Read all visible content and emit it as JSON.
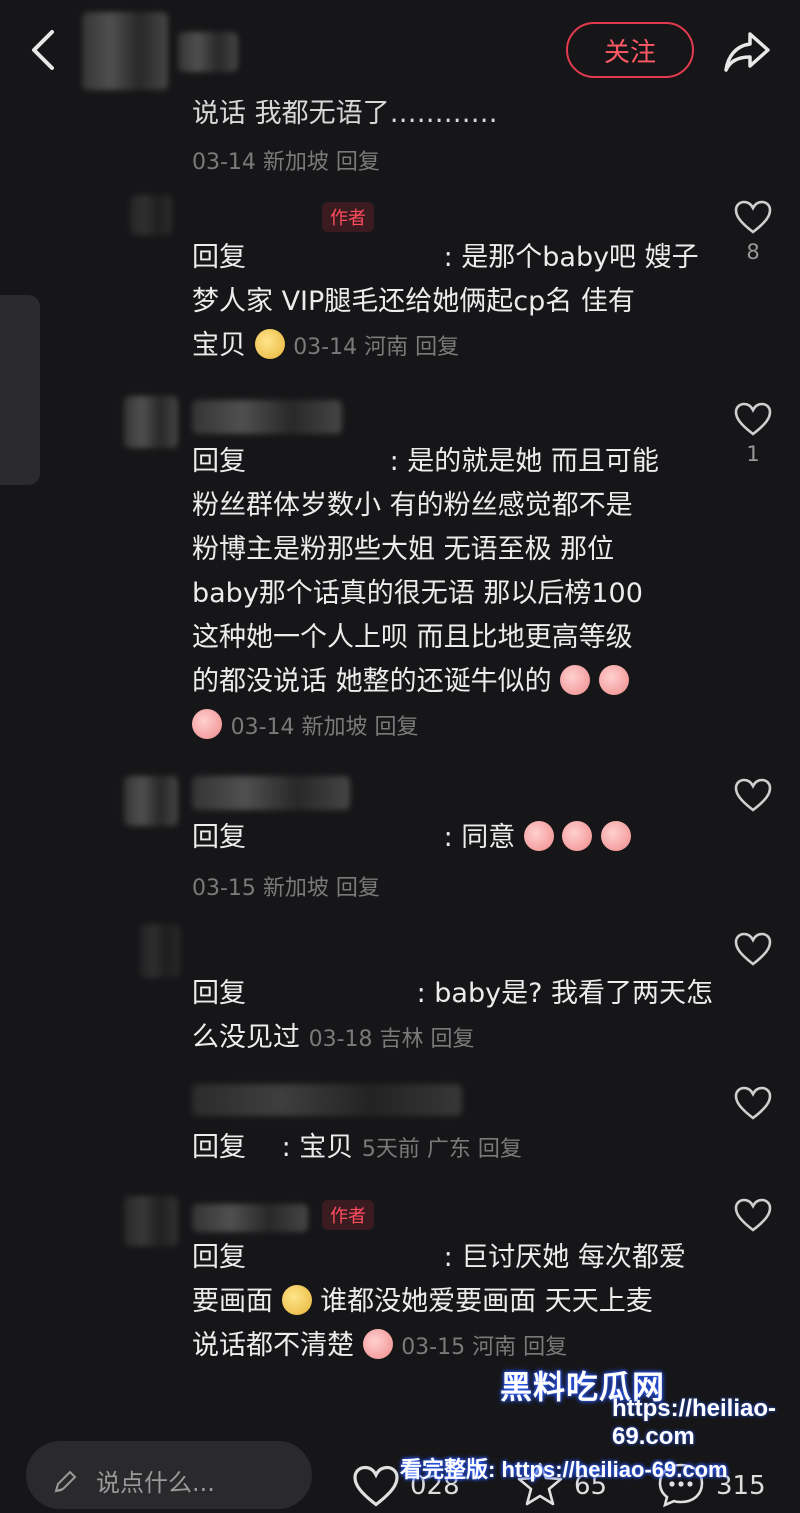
{
  "header": {
    "follow_label": "关注"
  },
  "partial": {
    "text": "说话 我都无语了…………",
    "meta": "03-14 新加坡 回复"
  },
  "comments": [
    {
      "author_tag": "作者",
      "lines": [
        "回复 　　　　　　　: 是那个baby吧 嫂子",
        "梦人家 VIP腿毛还给她俩起cp名 佳有",
        "宝贝"
      ],
      "meta": "03-14 河南 回复",
      "likes": "8"
    },
    {
      "lines": [
        "回复 　　　　　: 是的就是她  而且可能",
        "粉丝群体岁数小 有的粉丝感觉都不是",
        "粉博主是粉那些大姐 无语至极 那位",
        "baby那个话真的很无语 那以后榜100",
        "这种她一个人上呗 而且比地更高等级",
        "的都没说话 她整的还诞牛似的"
      ],
      "meta": "03-14 新加坡 回复",
      "likes": "1"
    },
    {
      "lines": [
        "回复 　　　　　　　: 同意"
      ],
      "meta": "03-15 新加坡 回复",
      "likes": ""
    },
    {
      "lines": [
        "回复 　　　　　　: baby是? 我看了两天怎",
        "么没见过"
      ],
      "meta": "03-18 吉林 回复",
      "likes": ""
    },
    {
      "lines": [
        "回复 　: 宝贝"
      ],
      "meta": "5天前 广东 回复",
      "likes": ""
    },
    {
      "author_tag": "作者",
      "lines": [
        "回复 　　　　　　　: 巨讨厌她 每次都爱",
        "要画面  谁都没她爱要画面 天天上麦",
        "说话都不清楚"
      ],
      "meta": "03-15 河南 回复",
      "likes": ""
    }
  ],
  "bottom": {
    "placeholder": "说点什么...",
    "like_count": "028",
    "star_count": "65",
    "comment_count": "315"
  },
  "watermark": {
    "brand": "黑料吃瓜网",
    "url": "https://heiliao-69.com",
    "cta": "看完整版: https://heiliao-69.com"
  },
  "icons": [
    "back-icon",
    "share-icon",
    "heart-icon",
    "star-icon",
    "comment-icon",
    "pencil-icon"
  ]
}
